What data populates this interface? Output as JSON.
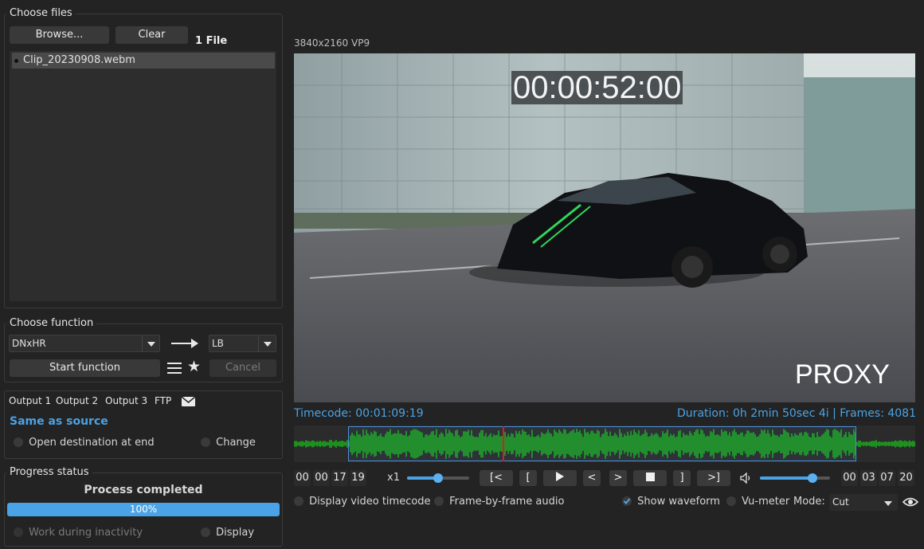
{
  "files": {
    "group_title": "Choose files",
    "browse_label": "Browse...",
    "clear_label": "Clear",
    "count_label": "1 File",
    "items": [
      "Clip_20230908.webm"
    ]
  },
  "function": {
    "group_title": "Choose function",
    "codec": "DNxHR",
    "profile": "LB",
    "start_label": "Start function",
    "cancel_label": "Cancel"
  },
  "output": {
    "tabs": [
      "Output 1",
      "Output 2",
      "Output 3",
      "FTP"
    ],
    "destination": "Same as source",
    "open_at_end_label": "Open destination at end",
    "change_label": "Change"
  },
  "progress": {
    "group_title": "Progress status",
    "status": "Process completed",
    "percent_text": "100%",
    "percent": 100,
    "work_inactivity_label": "Work during inactivity",
    "display_label": "Display"
  },
  "video": {
    "info": "3840x2160 VP9",
    "overlay_timecode": "00:00:52:00",
    "watermark": "PROXY",
    "timecode_label": "Timecode: 00:01:09:19",
    "duration_label": "Duration: 0h 2min 50sec 4i | Frames: 4081"
  },
  "player": {
    "current_tc": [
      "00",
      "00",
      "17",
      "19"
    ],
    "end_tc": [
      "00",
      "03",
      "07",
      "20"
    ],
    "speed_label": "x1",
    "speed_level": 0.5,
    "volume_level": 0.75,
    "buttons": {
      "go_start": "[<",
      "mark_in": "[",
      "prev_frame": "<",
      "next_frame": ">",
      "mark_out": "]",
      "go_end": ">]"
    }
  },
  "options": {
    "display_timecode_label": "Display video timecode",
    "frame_audio_label": "Frame-by-frame audio",
    "show_waveform_label": "Show waveform",
    "vu_meter_label": "Vu-meter",
    "mode_label": "Mode:",
    "mode_value": "Cut"
  },
  "colors": {
    "accent": "#4aa3e6",
    "waveform": "#1f8f1f",
    "playhead": "#d42020"
  }
}
